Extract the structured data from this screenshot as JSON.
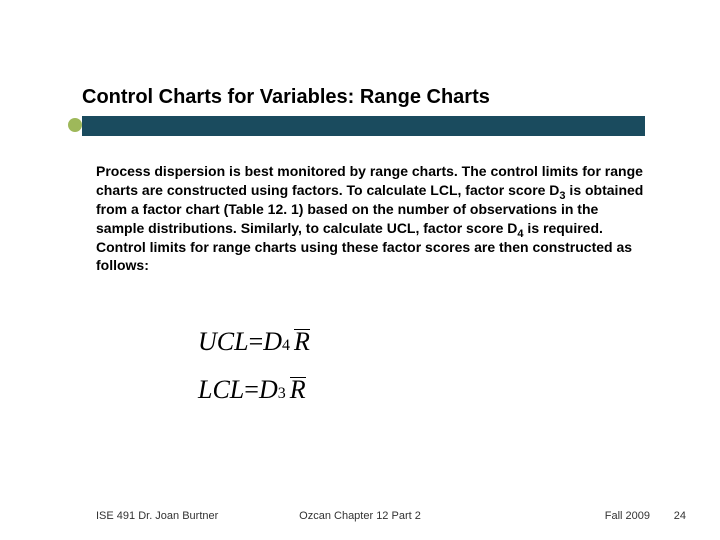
{
  "title": "Control Charts for Variables:  Range Charts",
  "body": {
    "p1a": "Process dispersion is best monitored by range charts.  The control limits for range charts are constructed using factors.  To calculate LCL, factor score D",
    "d3": "3",
    "p1b": " is obtained from a factor chart (Table 12. 1) based on the number of observations in the sample distributions. Similarly, to calculate UCL, factor score D",
    "d4": "4",
    "p1c": " is required.  Control limits for range charts using these factor scores are then constructed as follows:"
  },
  "equations": {
    "ucl_lhs": "UCL",
    "eq": " = ",
    "d": "D",
    "four": "4",
    "three": "3",
    "r": "R",
    "lcl_lhs": "LCL"
  },
  "footer": {
    "left": "ISE 491  Dr. Joan Burtner",
    "center": "Ozcan Chapter 12 Part 2",
    "right": "Fall 2009",
    "num": "24"
  }
}
